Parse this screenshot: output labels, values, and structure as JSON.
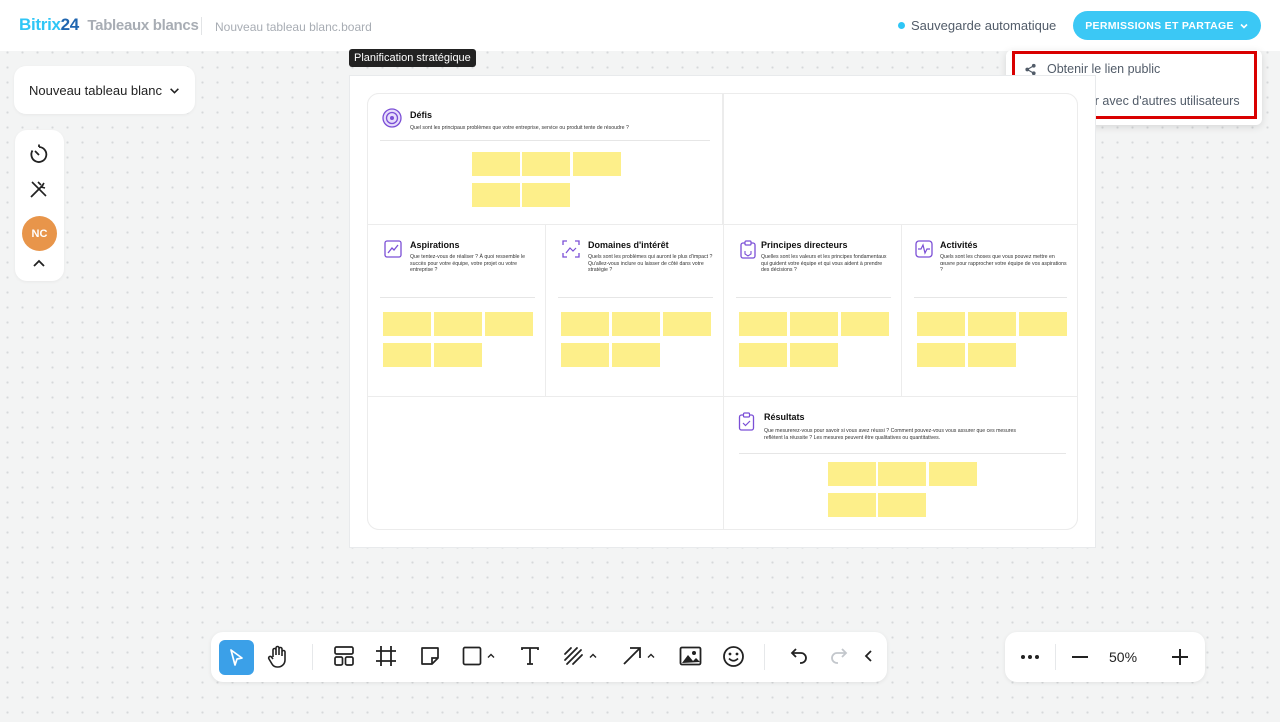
{
  "header": {
    "logo_b24_part1": "Bitrix",
    "logo_b24_part2": "24",
    "product": "Tableaux blancs",
    "filename": "Nouveau tableau blanc.board",
    "autosave": "Sauvegarde automatique",
    "permissions_button": "PERMISSIONS ET PARTAGE"
  },
  "dropdown": {
    "items": [
      {
        "label": "Obtenir le lien public",
        "icon": "share-icon"
      },
      {
        "label": "Partager avec d'autres utilisateurs",
        "icon": "add-users-icon"
      }
    ]
  },
  "board": {
    "title": "Nouveau tableau blanc"
  },
  "left_tools": {
    "avatar_initials": "NC"
  },
  "frame": {
    "label": "Planification stratégique",
    "cards": {
      "defis": {
        "title": "Défis",
        "desc": "Quel sont les principaux problèmes que votre entreprise, service ou produit tente de résoudre ?"
      },
      "aspirations": {
        "title": "Aspirations",
        "desc": "Que tentez-vous de réaliser ? À quoi ressemble le succès pour votre équipe, votre projet ou votre entreprise ?"
      },
      "domaines": {
        "title": "Domaines d'intérêt",
        "desc": "Quels sont les problèmes qui auront le plus d'impact ? Qu'allez-vous inclure ou laisser de côté dans votre stratégie ?"
      },
      "principes": {
        "title": "Principes directeurs",
        "desc": "Quelles sont les valeurs et les principes fondamentaux qui guident votre équipe et qui vous aident à prendre des décisions ?"
      },
      "activites": {
        "title": "Activités",
        "desc": "Quels sont les choses que vous pouvez mettre en œuvre pour rapprocher votre équipe de vos aspirations ?"
      },
      "resultats": {
        "title": "Résultats",
        "desc": "Que mesurerez-vous pour savoir si vous avez réussi ? Comment pouvez-vous vous assurer que ces mesures reflètent la réussite ? Les mesures peuvent être qualitatives ou quantitatives."
      }
    }
  },
  "zoom": {
    "value": "50%"
  }
}
